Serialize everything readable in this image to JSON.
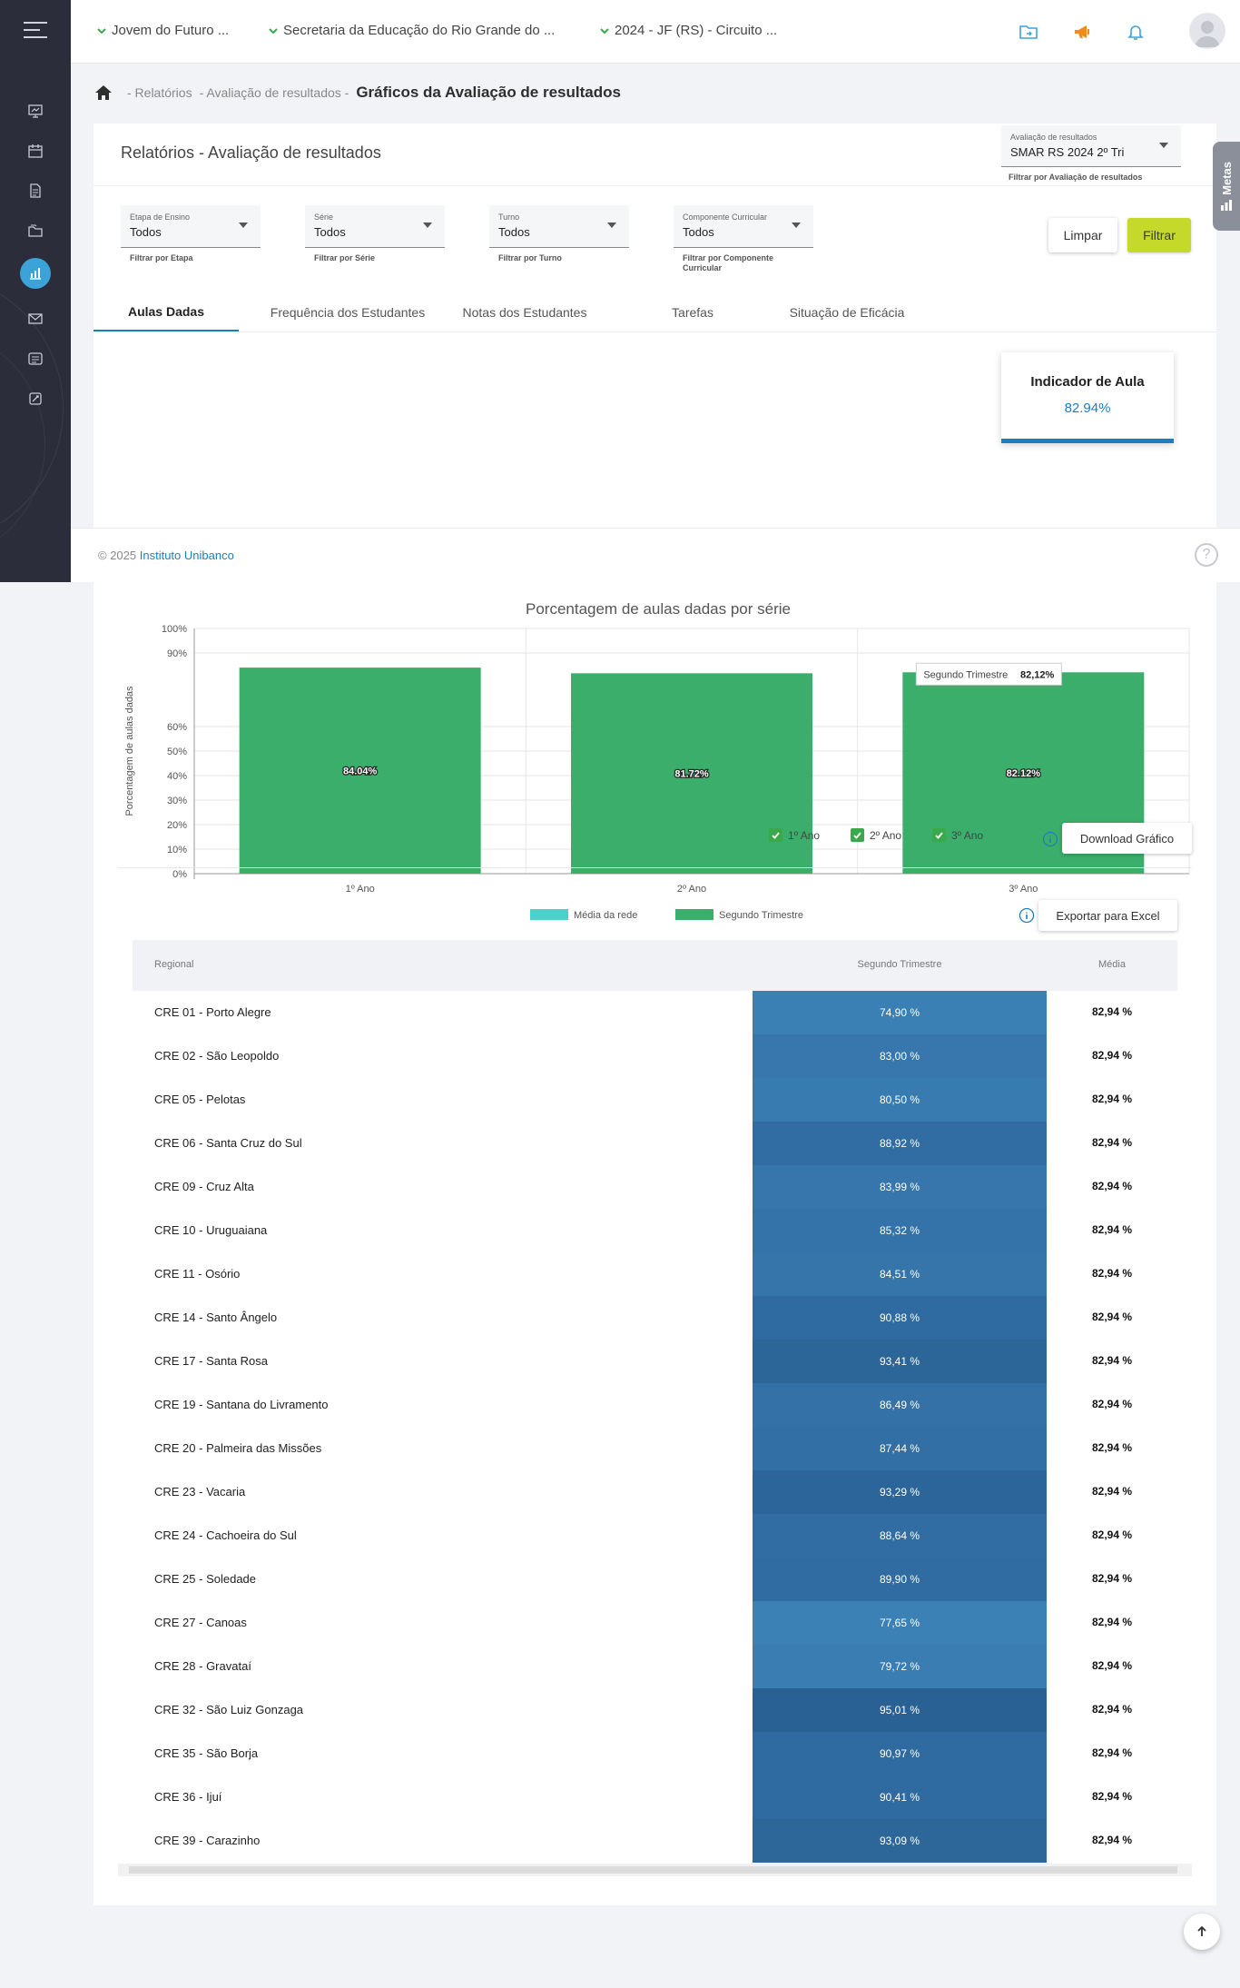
{
  "topbar": {
    "selectors": [
      "Jovem do Futuro ...",
      "Secretaria da Educação do Rio Grande do ...",
      "2024 - JF (RS) - Circuito ..."
    ],
    "icons": [
      "folder-icon",
      "megaphone-icon",
      "bell-icon",
      "avatar-icon"
    ]
  },
  "sidebar": {
    "icons": [
      "presentation-icon",
      "calendar-icon",
      "document-icon",
      "folders-icon",
      "chart-icon",
      "mail-icon",
      "checklist-icon",
      "tools-icon"
    ],
    "active": "chart-icon"
  },
  "breadcrumb": {
    "items": [
      "- Relatórios",
      "- Avaliação de resultados -"
    ],
    "current": "Gráficos da Avaliação de resultados"
  },
  "metas_label": "Metas",
  "card": {
    "title": "Relatórios - Avaliação de resultados",
    "avaliacao": {
      "label": "Avaliação de resultados",
      "value": "SMAR RS 2024 2º Tri",
      "hint": "Filtrar por Avaliação de resultados"
    },
    "filters": [
      {
        "label": "Etapa de Ensino",
        "value": "Todos",
        "hint": "Filtrar por Etapa"
      },
      {
        "label": "Série",
        "value": "Todos",
        "hint": "Filtrar por Série"
      },
      {
        "label": "Turno",
        "value": "Todos",
        "hint": "Filtrar por Turno"
      },
      {
        "label": "Componente Curricular",
        "value": "Todos",
        "hint": "Filtrar por Componente Curricular"
      }
    ],
    "buttons": {
      "limpar": "Limpar",
      "filtrar": "Filtrar"
    },
    "tabs": [
      "Aulas Dadas",
      "Frequência dos Estudantes",
      "Notas dos Estudantes",
      "Tarefas",
      "Situação de Eficácia"
    ],
    "indicator": {
      "title": "Indicador de Aula",
      "value": "82.94%"
    },
    "chart_checks": [
      "1º Ano",
      "2º Ano",
      "3º Ano"
    ],
    "download_label": "Download Gráfico",
    "export_label": "Exportar para Excel"
  },
  "chart_data": {
    "type": "bar",
    "title": "Porcentagem de aulas dadas por série",
    "ylabel": "Porcentagem de aulas dadas",
    "categories": [
      "1º Ano",
      "2º Ano",
      "3º Ano"
    ],
    "series": [
      {
        "name": "Média da rede",
        "color": "#4dd0c9",
        "values": []
      },
      {
        "name": "Segundo Trimestre",
        "color": "#3aae6a",
        "values": [
          84.04,
          81.72,
          82.12
        ]
      }
    ],
    "data_labels": [
      "84.04%",
      "81.72%",
      "82.12%"
    ],
    "tooltip": {
      "label": "Segundo Trimestre",
      "value": "82,12%"
    },
    "yticks": [
      "0%",
      "10%",
      "20%",
      "30%",
      "40%",
      "50%",
      "60%",
      "90%",
      "100%"
    ],
    "ylim": [
      0,
      100
    ],
    "grid": true,
    "legend": "bottom"
  },
  "table": {
    "headers": [
      "Regional",
      "Segundo Trimestre",
      "Média"
    ],
    "rows": [
      {
        "regional": "CRE 01 - Porto Alegre",
        "trimestre": "74,90 %",
        "media": "82,94 %",
        "color": "#3a80b5"
      },
      {
        "regional": "CRE 02 - São Leopoldo",
        "trimestre": "83,00 %",
        "media": "82,94 %",
        "color": "#3777ad"
      },
      {
        "regional": "CRE 05 - Pelotas",
        "trimestre": "80,50 %",
        "media": "82,94 %",
        "color": "#387bb1"
      },
      {
        "regional": "CRE 06 - Santa Cruz do Sul",
        "trimestre": "88,92 %",
        "media": "82,94 %",
        "color": "#316da3"
      },
      {
        "regional": "CRE 09 - Cruz Alta",
        "trimestre": "83,99 %",
        "media": "82,94 %",
        "color": "#3676ac"
      },
      {
        "regional": "CRE 10 - Uruguaiana",
        "trimestre": "85,32 %",
        "media": "82,94 %",
        "color": "#3473a9"
      },
      {
        "regional": "CRE 11 - Osório",
        "trimestre": "84,51 %",
        "media": "82,94 %",
        "color": "#3575aa"
      },
      {
        "regional": "CRE 14 - Santo Ângelo",
        "trimestre": "90,88 %",
        "media": "82,94 %",
        "color": "#2f6aa0"
      },
      {
        "regional": "CRE 17 - Santa Rosa",
        "trimestre": "93,41 %",
        "media": "82,94 %",
        "color": "#2c6598"
      },
      {
        "regional": "CRE 19 - Santana do Livramento",
        "trimestre": "86,49 %",
        "media": "82,94 %",
        "color": "#3371a7"
      },
      {
        "regional": "CRE 20 - Palmeira das Missões",
        "trimestre": "87,44 %",
        "media": "82,94 %",
        "color": "#326fa5"
      },
      {
        "regional": "CRE 23 - Vacaria",
        "trimestre": "93,29 %",
        "media": "82,94 %",
        "color": "#2c6599"
      },
      {
        "regional": "CRE 24 - Cachoeira do Sul",
        "trimestre": "88,64 %",
        "media": "82,94 %",
        "color": "#316da3"
      },
      {
        "regional": "CRE 25 - Soledade",
        "trimestre": "89,90 %",
        "media": "82,94 %",
        "color": "#306ba1"
      },
      {
        "regional": "CRE 27 - Canoas",
        "trimestre": "77,65 %",
        "media": "82,94 %",
        "color": "#3b81b6"
      },
      {
        "regional": "CRE 28 - Gravataí",
        "trimestre": "79,72 %",
        "media": "82,94 %",
        "color": "#397db2"
      },
      {
        "regional": "CRE 32 - São Luiz Gonzaga",
        "trimestre": "95,01 %",
        "media": "82,94 %",
        "color": "#2a6195"
      },
      {
        "regional": "CRE 35 - São Borja",
        "trimestre": "90,97 %",
        "media": "82,94 %",
        "color": "#2f6aa0"
      },
      {
        "regional": "CRE 36 - Ijuí",
        "trimestre": "90,41 %",
        "media": "82,94 %",
        "color": "#2f6ba1"
      },
      {
        "regional": "CRE 39 - Carazinho",
        "trimestre": "93,09 %",
        "media": "82,94 %",
        "color": "#2d6699"
      }
    ]
  },
  "footer": {
    "copyright": "© 2025",
    "brand": "Instituto Unibanco"
  }
}
